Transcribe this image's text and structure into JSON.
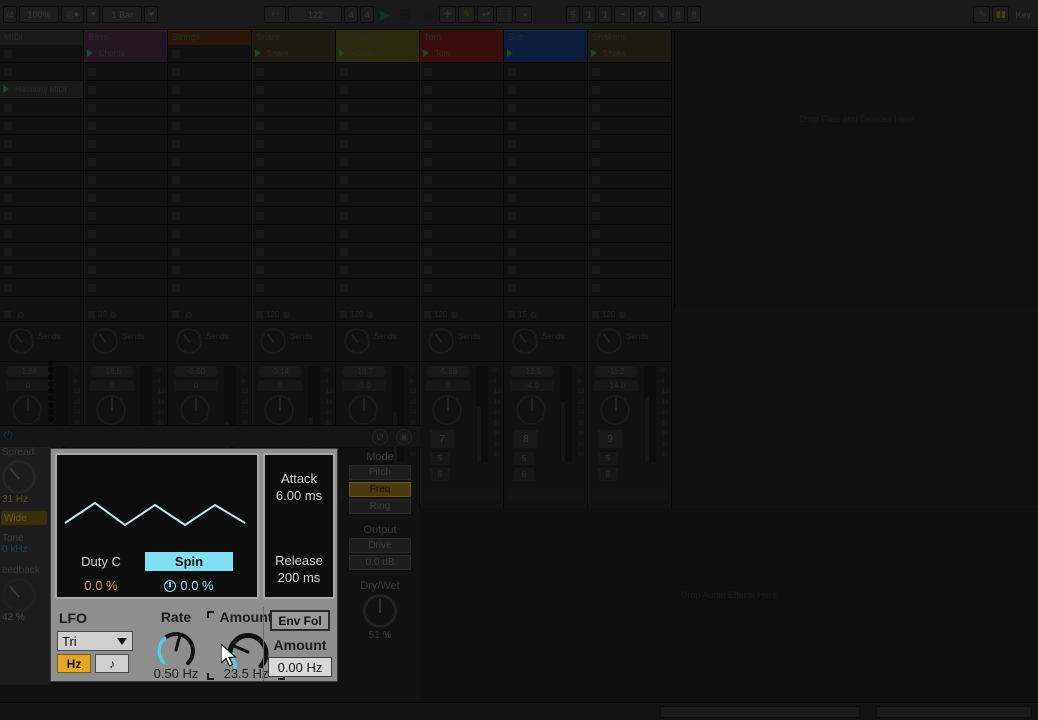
{
  "topbar": {
    "signature": "/4",
    "groove": "100%",
    "metronome_icon": "metronome-icon",
    "quantize": "1 Bar",
    "tap_icon": "tap-tempo-icon",
    "tempo": "122",
    "time_sig_num": "4",
    "time_sig_den": "4",
    "play_icon": "play-icon",
    "stop_icon": "stop-icon",
    "record_icon": "record-icon",
    "plus_icon": "plus-icon",
    "pencil_icon": "pencil-icon",
    "position_bars": "5",
    "position_beats": "1",
    "position_sixteenths": "1",
    "draw_icon": "draw-mode-icon",
    "loop_icon": "loop-icon",
    "punch_in_icon": "punch-in-icon",
    "loop_start": "8",
    "loop_length": "8",
    "cpu_icon": "cpu-meter-icon",
    "key_label": "Key"
  },
  "session": {
    "tracks": [
      {
        "name": "MIDI",
        "color": "#1a1a1a",
        "clip": "Harmony MIDI",
        "clip_row": 2,
        "has_play": true
      },
      {
        "name": "Bass",
        "color": "#241622",
        "clip": "Chords",
        "clip_row": 0,
        "has_play": true
      },
      {
        "name": "Strings",
        "color": "#2a1608",
        "clip": "",
        "clip_row": -1,
        "has_play": false
      },
      {
        "name": "Snare",
        "color": "#1e1a10",
        "clip": "Snare",
        "clip_row": 0,
        "has_play": true
      },
      {
        "name": "Cymbal",
        "color": "#2a2a0e",
        "clip": "+Cym",
        "clip_row": 0,
        "has_play": true
      },
      {
        "name": "Tom",
        "color": "#3a0d0d",
        "clip": "Tom",
        "clip_row": 0,
        "has_play": true
      },
      {
        "name": "Sub",
        "color": "#0d1c3a",
        "clip": "",
        "clip_row": 0,
        "has_play": true
      },
      {
        "name": "Shakers",
        "color": "#1e1a10",
        "clip": "Shake",
        "clip_row": 0,
        "has_play": true
      }
    ],
    "browser_drop_hint": "Drop Files and Devices Here"
  },
  "mixer": {
    "sends_label": "Sends",
    "strips": [
      {
        "quant": "",
        "vol": "-1.86",
        "pan": "0",
        "num": "",
        "a": "",
        "b": ""
      },
      {
        "quant": "30",
        "vol": "-18.6",
        "pan": "0",
        "num": "",
        "a": "",
        "b": ""
      },
      {
        "quant": "",
        "vol": "-0.50",
        "pan": "0",
        "num": "",
        "a": "",
        "b": ""
      },
      {
        "quant": "120",
        "vol": "-3.14",
        "pan": "0",
        "num": "",
        "a": "",
        "b": ""
      },
      {
        "quant": "120",
        "vol": "-18.7",
        "pan": "-3.0",
        "num": "",
        "a": "",
        "b": ""
      },
      {
        "quant": "120",
        "vol": "-5.88",
        "pan": "0",
        "num": "7",
        "a": "5",
        "b": "6"
      },
      {
        "quant": "15",
        "vol": "-12.1",
        "pan": "-4.0",
        "num": "8",
        "a": "5",
        "b": "6"
      },
      {
        "quant": "120",
        "vol": "-11.2",
        "pan": "-14.0",
        "num": "9",
        "a": "5",
        "b": "8"
      }
    ],
    "scale_ticks": [
      "0",
      "6",
      "12",
      "18",
      "24",
      "30",
      "36",
      "48",
      "60"
    ]
  },
  "device_chain": {
    "power_icon": "device-power-icon",
    "phase_icon": "phase-invert-icon",
    "lock_icon": "device-lock-icon",
    "fx_drop_hint": "Drop Audio Effects Here"
  },
  "left_device": {
    "spread_label": "Spread",
    "spread_value": "31 Hz",
    "wide_label": "Wide",
    "tone_label": "Tone",
    "tone_value": "0 kHz",
    "feedback_label": "eedback",
    "feedback_value": "42 %"
  },
  "lfo_device": {
    "display": {
      "duty_label": "Duty C",
      "duty_value": "0.0 %",
      "spin_label": "Spin",
      "spin_value": "0.0 %",
      "spin_icon": "phase-dial-icon",
      "waveform": "triangle",
      "wave_color": "#bfe9ee"
    },
    "envelope": {
      "attack_label": "Attack",
      "attack_value": "6.00 ms",
      "release_label": "Release",
      "release_value": "200 ms"
    },
    "controls": {
      "title": "LFO",
      "shape_selected": "Tri",
      "shape_caret_icon": "chevron-down-icon",
      "hz_label": "Hz",
      "note_label": "♪",
      "hz_active": true,
      "rate_label": "Rate",
      "rate_value": "0.50 Hz",
      "amount_label": "Amount",
      "amount_value": "23.5 Hz"
    },
    "env_follower": {
      "title": "Env Fol",
      "amount_label": "Amount",
      "amount_value": "0.00 Hz"
    },
    "colors": {
      "panel": "#8e8e8e",
      "accent_cyan": "#7ee0f2",
      "accent_orange": "#e8a726",
      "duty_orange": "#d09a28"
    }
  },
  "right_column": {
    "mode_label": "Mode",
    "mode_options": [
      "Pitch",
      "Freq",
      "Ring"
    ],
    "mode_selected": "Freq",
    "output_label": "Output",
    "drive_label": "Drive",
    "gain_value": "0.0 dB",
    "drywet_label": "Dry/Wet",
    "drywet_value": "51 %"
  }
}
